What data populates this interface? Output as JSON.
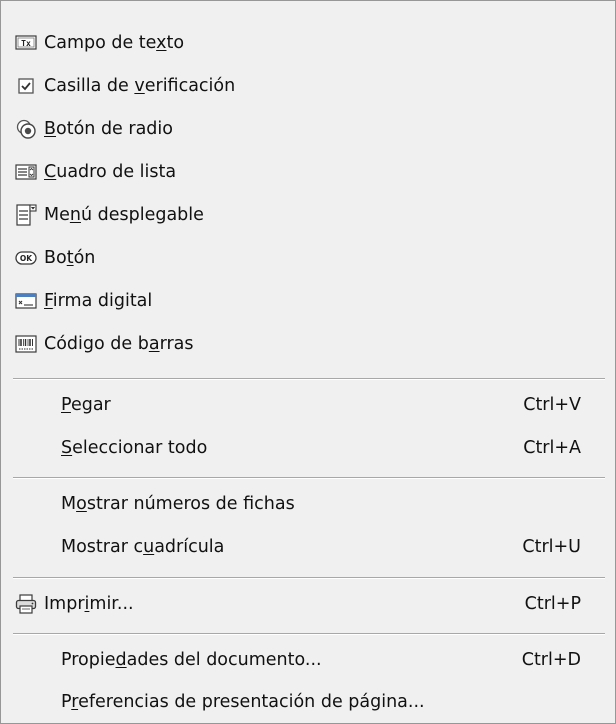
{
  "menu": {
    "items": [
      {
        "pre": "Campo de te",
        "u": "x",
        "post": "to",
        "icon": "text-field-icon"
      },
      {
        "pre": "Casilla de ",
        "u": "v",
        "post": "erificación",
        "icon": "checkbox-icon"
      },
      {
        "pre": "",
        "u": "B",
        "post": "otón de radio",
        "icon": "radio-button-icon"
      },
      {
        "pre": "",
        "u": "C",
        "post": "uadro de lista",
        "icon": "list-box-icon"
      },
      {
        "pre": "Me",
        "u": "n",
        "post": "ú desplegable",
        "icon": "dropdown-menu-icon"
      },
      {
        "pre": "Bo",
        "u": "t",
        "post": "ón",
        "icon": "ok-button-icon"
      },
      {
        "pre": "",
        "u": "F",
        "post": "irma digital",
        "icon": "digital-signature-icon"
      },
      {
        "pre": "Código de b",
        "u": "a",
        "post": "rras",
        "icon": "barcode-icon"
      },
      {
        "pre": "",
        "u": "P",
        "post": "egar",
        "shortcut": "Ctrl+V"
      },
      {
        "pre": "",
        "u": "S",
        "post": "eleccionar todo",
        "shortcut": "Ctrl+A"
      },
      {
        "pre": "M",
        "u": "o",
        "post": "strar números de fichas"
      },
      {
        "pre": "Mostrar c",
        "u": "u",
        "post": "adrícula",
        "shortcut": "Ctrl+U"
      },
      {
        "pre": "Impr",
        "u": "i",
        "post": "mir...",
        "shortcut": "Ctrl+P",
        "icon": "printer-icon"
      },
      {
        "pre": "Propie",
        "u": "d",
        "post": "ades del documento...",
        "shortcut": "Ctrl+D"
      },
      {
        "pre": "P",
        "u": "r",
        "post": "eferencias de presentación de página..."
      }
    ]
  }
}
